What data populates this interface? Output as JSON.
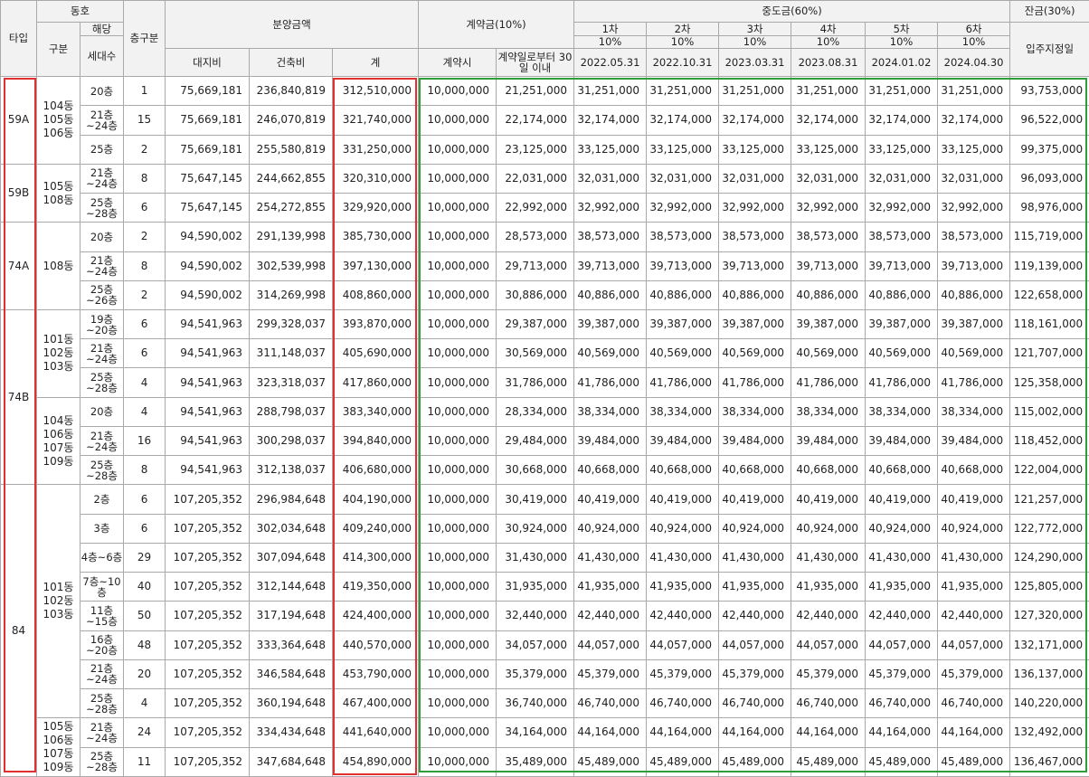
{
  "headers": {
    "type": "타입",
    "dong_group": "동호",
    "dong": "구분",
    "floor": "층구분",
    "units_group": "해당",
    "units": "세대수",
    "sale_price": "분양금액",
    "land": "대지비",
    "building": "건축비",
    "total": "계",
    "deposit": "계약금(10%)",
    "deposit_at_contract": "계약시",
    "deposit_within_30": "계약일로부터 30일 이내",
    "interim": "중도금(60%)",
    "interim_rounds": [
      {
        "label": "1차",
        "pct": "10%",
        "date": "2022.05.31"
      },
      {
        "label": "2차",
        "pct": "10%",
        "date": "2022.10.31"
      },
      {
        "label": "3차",
        "pct": "10%",
        "date": "2023.03.31"
      },
      {
        "label": "4차",
        "pct": "10%",
        "date": "2023.08.31"
      },
      {
        "label": "5차",
        "pct": "10%",
        "date": "2024.01.02"
      },
      {
        "label": "6차",
        "pct": "10%",
        "date": "2024.04.30"
      }
    ],
    "balance": "잔금(30%)",
    "balance_when": "입주지정일"
  },
  "groups": [
    {
      "type": "59A",
      "dong_blocks": [
        {
          "dong": "104동 105동 106동",
          "rows": [
            {
              "floor": "20층",
              "units": "1",
              "land": "75,669,181",
              "building": "236,840,819",
              "total": "312,510,000",
              "dep1": "10,000,000",
              "dep2": "21,251,000",
              "interim": "31,251,000",
              "balance": "93,753,000"
            },
            {
              "floor": "21층~24층",
              "units": "15",
              "land": "75,669,181",
              "building": "246,070,819",
              "total": "321,740,000",
              "dep1": "10,000,000",
              "dep2": "22,174,000",
              "interim": "32,174,000",
              "balance": "96,522,000"
            },
            {
              "floor": "25층",
              "units": "2",
              "land": "75,669,181",
              "building": "255,580,819",
              "total": "331,250,000",
              "dep1": "10,000,000",
              "dep2": "23,125,000",
              "interim": "33,125,000",
              "balance": "99,375,000"
            }
          ]
        }
      ]
    },
    {
      "type": "59B",
      "dong_blocks": [
        {
          "dong": "105동 108동",
          "rows": [
            {
              "floor": "21층~24층",
              "units": "8",
              "land": "75,647,145",
              "building": "244,662,855",
              "total": "320,310,000",
              "dep1": "10,000,000",
              "dep2": "22,031,000",
              "interim": "32,031,000",
              "balance": "96,093,000"
            },
            {
              "floor": "25층~28층",
              "units": "6",
              "land": "75,647,145",
              "building": "254,272,855",
              "total": "329,920,000",
              "dep1": "10,000,000",
              "dep2": "22,992,000",
              "interim": "32,992,000",
              "balance": "98,976,000"
            }
          ]
        }
      ]
    },
    {
      "type": "74A",
      "dong_blocks": [
        {
          "dong": "108동",
          "rows": [
            {
              "floor": "20층",
              "units": "2",
              "land": "94,590,002",
              "building": "291,139,998",
              "total": "385,730,000",
              "dep1": "10,000,000",
              "dep2": "28,573,000",
              "interim": "38,573,000",
              "balance": "115,719,000"
            },
            {
              "floor": "21층~24층",
              "units": "8",
              "land": "94,590,002",
              "building": "302,539,998",
              "total": "397,130,000",
              "dep1": "10,000,000",
              "dep2": "29,713,000",
              "interim": "39,713,000",
              "balance": "119,139,000"
            },
            {
              "floor": "25층~26층",
              "units": "2",
              "land": "94,590,002",
              "building": "314,269,998",
              "total": "408,860,000",
              "dep1": "10,000,000",
              "dep2": "30,886,000",
              "interim": "40,886,000",
              "balance": "122,658,000"
            }
          ]
        }
      ]
    },
    {
      "type": "74B",
      "dong_blocks": [
        {
          "dong": "101동 102동 103동",
          "rows": [
            {
              "floor": "19층~20층",
              "units": "6",
              "land": "94,541,963",
              "building": "299,328,037",
              "total": "393,870,000",
              "dep1": "10,000,000",
              "dep2": "29,387,000",
              "interim": "39,387,000",
              "balance": "118,161,000"
            },
            {
              "floor": "21층~24층",
              "units": "6",
              "land": "94,541,963",
              "building": "311,148,037",
              "total": "405,690,000",
              "dep1": "10,000,000",
              "dep2": "30,569,000",
              "interim": "40,569,000",
              "balance": "121,707,000"
            },
            {
              "floor": "25층~28층",
              "units": "4",
              "land": "94,541,963",
              "building": "323,318,037",
              "total": "417,860,000",
              "dep1": "10,000,000",
              "dep2": "31,786,000",
              "interim": "41,786,000",
              "balance": "125,358,000"
            }
          ]
        },
        {
          "dong": "104동 106동 107동 109동",
          "rows": [
            {
              "floor": "20층",
              "units": "4",
              "land": "94,541,963",
              "building": "288,798,037",
              "total": "383,340,000",
              "dep1": "10,000,000",
              "dep2": "28,334,000",
              "interim": "38,334,000",
              "balance": "115,002,000"
            },
            {
              "floor": "21층~24층",
              "units": "16",
              "land": "94,541,963",
              "building": "300,298,037",
              "total": "394,840,000",
              "dep1": "10,000,000",
              "dep2": "29,484,000",
              "interim": "39,484,000",
              "balance": "118,452,000"
            },
            {
              "floor": "25층~28층",
              "units": "8",
              "land": "94,541,963",
              "building": "312,138,037",
              "total": "406,680,000",
              "dep1": "10,000,000",
              "dep2": "30,668,000",
              "interim": "40,668,000",
              "balance": "122,004,000"
            }
          ]
        }
      ]
    },
    {
      "type": "84",
      "dong_blocks": [
        {
          "dong": "101동 102동 103동",
          "rows": [
            {
              "floor": "2층",
              "units": "6",
              "land": "107,205,352",
              "building": "296,984,648",
              "total": "404,190,000",
              "dep1": "10,000,000",
              "dep2": "30,419,000",
              "interim": "40,419,000",
              "balance": "121,257,000"
            },
            {
              "floor": "3층",
              "units": "6",
              "land": "107,205,352",
              "building": "302,034,648",
              "total": "409,240,000",
              "dep1": "10,000,000",
              "dep2": "30,924,000",
              "interim": "40,924,000",
              "balance": "122,772,000"
            },
            {
              "floor": "4층~6층",
              "units": "29",
              "land": "107,205,352",
              "building": "307,094,648",
              "total": "414,300,000",
              "dep1": "10,000,000",
              "dep2": "31,430,000",
              "interim": "41,430,000",
              "balance": "124,290,000"
            },
            {
              "floor": "7층~10층",
              "units": "40",
              "land": "107,205,352",
              "building": "312,144,648",
              "total": "419,350,000",
              "dep1": "10,000,000",
              "dep2": "31,935,000",
              "interim": "41,935,000",
              "balance": "125,805,000"
            },
            {
              "floor": "11층~15층",
              "units": "50",
              "land": "107,205,352",
              "building": "317,194,648",
              "total": "424,400,000",
              "dep1": "10,000,000",
              "dep2": "32,440,000",
              "interim": "42,440,000",
              "balance": "127,320,000"
            },
            {
              "floor": "16층~20층",
              "units": "48",
              "land": "107,205,352",
              "building": "333,364,648",
              "total": "440,570,000",
              "dep1": "10,000,000",
              "dep2": "34,057,000",
              "interim": "44,057,000",
              "balance": "132,171,000"
            },
            {
              "floor": "21층~24층",
              "units": "20",
              "land": "107,205,352",
              "building": "346,584,648",
              "total": "453,790,000",
              "dep1": "10,000,000",
              "dep2": "35,379,000",
              "interim": "45,379,000",
              "balance": "136,137,000"
            },
            {
              "floor": "25층~28층",
              "units": "4",
              "land": "107,205,352",
              "building": "360,194,648",
              "total": "467,400,000",
              "dep1": "10,000,000",
              "dep2": "36,740,000",
              "interim": "46,740,000",
              "balance": "140,220,000"
            }
          ]
        },
        {
          "dong": "105동 106동 107동 109동",
          "rows": [
            {
              "floor": "21층~24층",
              "units": "24",
              "land": "107,205,352",
              "building": "334,434,648",
              "total": "441,640,000",
              "dep1": "10,000,000",
              "dep2": "34,164,000",
              "interim": "44,164,000",
              "balance": "132,492,000"
            },
            {
              "floor": "25층~28층",
              "units": "11",
              "land": "107,205,352",
              "building": "347,684,648",
              "total": "454,890,000",
              "dep1": "10,000,000",
              "dep2": "35,489,000",
              "interim": "45,489,000",
              "balance": "136,467,000"
            }
          ]
        }
      ]
    }
  ],
  "highlight_colors": {
    "type_box": "#e03030",
    "total_box": "#e03030",
    "payment_box": "#2f9e3a"
  }
}
